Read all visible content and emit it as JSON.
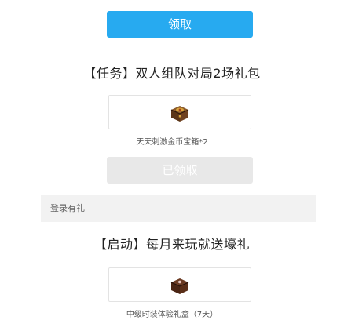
{
  "claim_button_label": "领取",
  "task": {
    "title": "【任务】双人组队对局2场礼包",
    "reward_name": "天天刺激金币宝箱*2",
    "reward_icon": "treasure-chest-icon",
    "claimed_button_label": "已领取"
  },
  "login_section": {
    "header": "登录有礼",
    "title": "【启动】每月来玩就送壕礼",
    "reward_name": "中级时装体验礼盒（7天）",
    "reward_icon": "gift-box-icon"
  },
  "colors": {
    "primary": "#27aaf0",
    "disabled": "#e8e8e8",
    "section_bg": "#f2f2f2"
  }
}
